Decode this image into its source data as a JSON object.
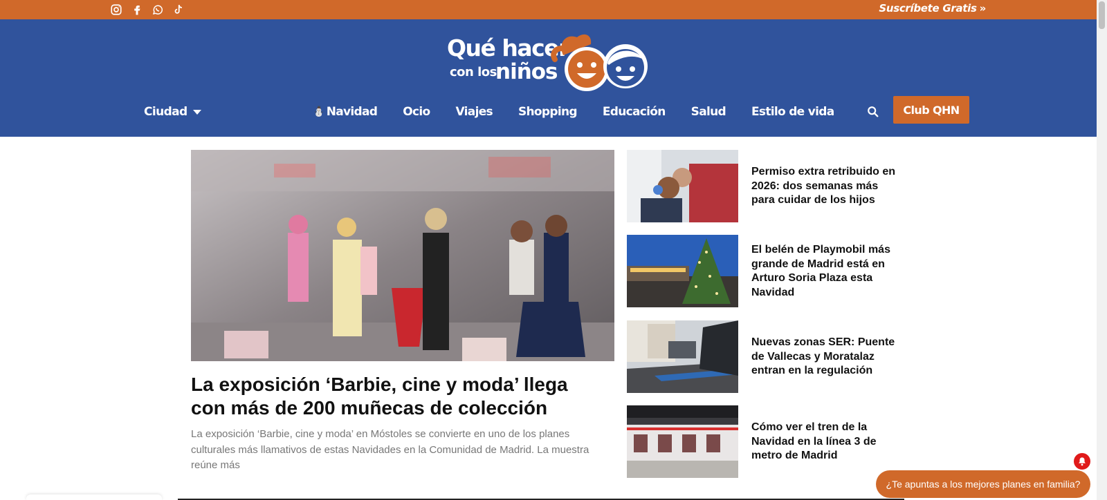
{
  "topbar": {
    "socials": [
      "instagram-icon",
      "facebook-icon",
      "whatsapp-icon",
      "tiktok-icon"
    ],
    "subscribe_label": "Suscríbete Gratis",
    "subscribe_arrows": "»"
  },
  "brand": {
    "line1": "Qué hacer",
    "line2": "con los",
    "line3": "niños"
  },
  "nav": {
    "city_label": "Ciudad",
    "items": [
      {
        "label": "Navidad",
        "icon": "snowman-icon"
      },
      {
        "label": "Ocio"
      },
      {
        "label": "Viajes"
      },
      {
        "label": "Shopping"
      },
      {
        "label": "Educación"
      },
      {
        "label": "Salud"
      },
      {
        "label": "Estilo de vida"
      }
    ],
    "club_label": "Club QHN"
  },
  "featured": {
    "title": "La exposición ‘Barbie, cine y moda’ llega con más de 200 muñecas de colección",
    "excerpt": "La exposición ‘Barbie, cine y moda’ en Móstoles se convierte en uno de los planes culturales más llamativos de estas Navidades en la Comunidad de Madrid. La muestra reúne más"
  },
  "side_articles": [
    {
      "title": "Permiso extra retribuido en 2026: dos semanas más para cuidar de los hijos"
    },
    {
      "title": "El belén de Playmobil más grande de Madrid está en Arturo Soria Plaza esta Navidad"
    },
    {
      "title": "Nuevas zonas SER: Puente de Vallecas y Moratalaz entran en la regulación"
    },
    {
      "title": "Cómo ver el tren de la Navidad en la línea 3 de metro de Madrid"
    }
  ],
  "cta_label": "¿Te apuntas a los mejores planes en familia?",
  "colors": {
    "orange": "#d0692a",
    "blue": "#30539c",
    "alert_red": "#e01a1a"
  }
}
